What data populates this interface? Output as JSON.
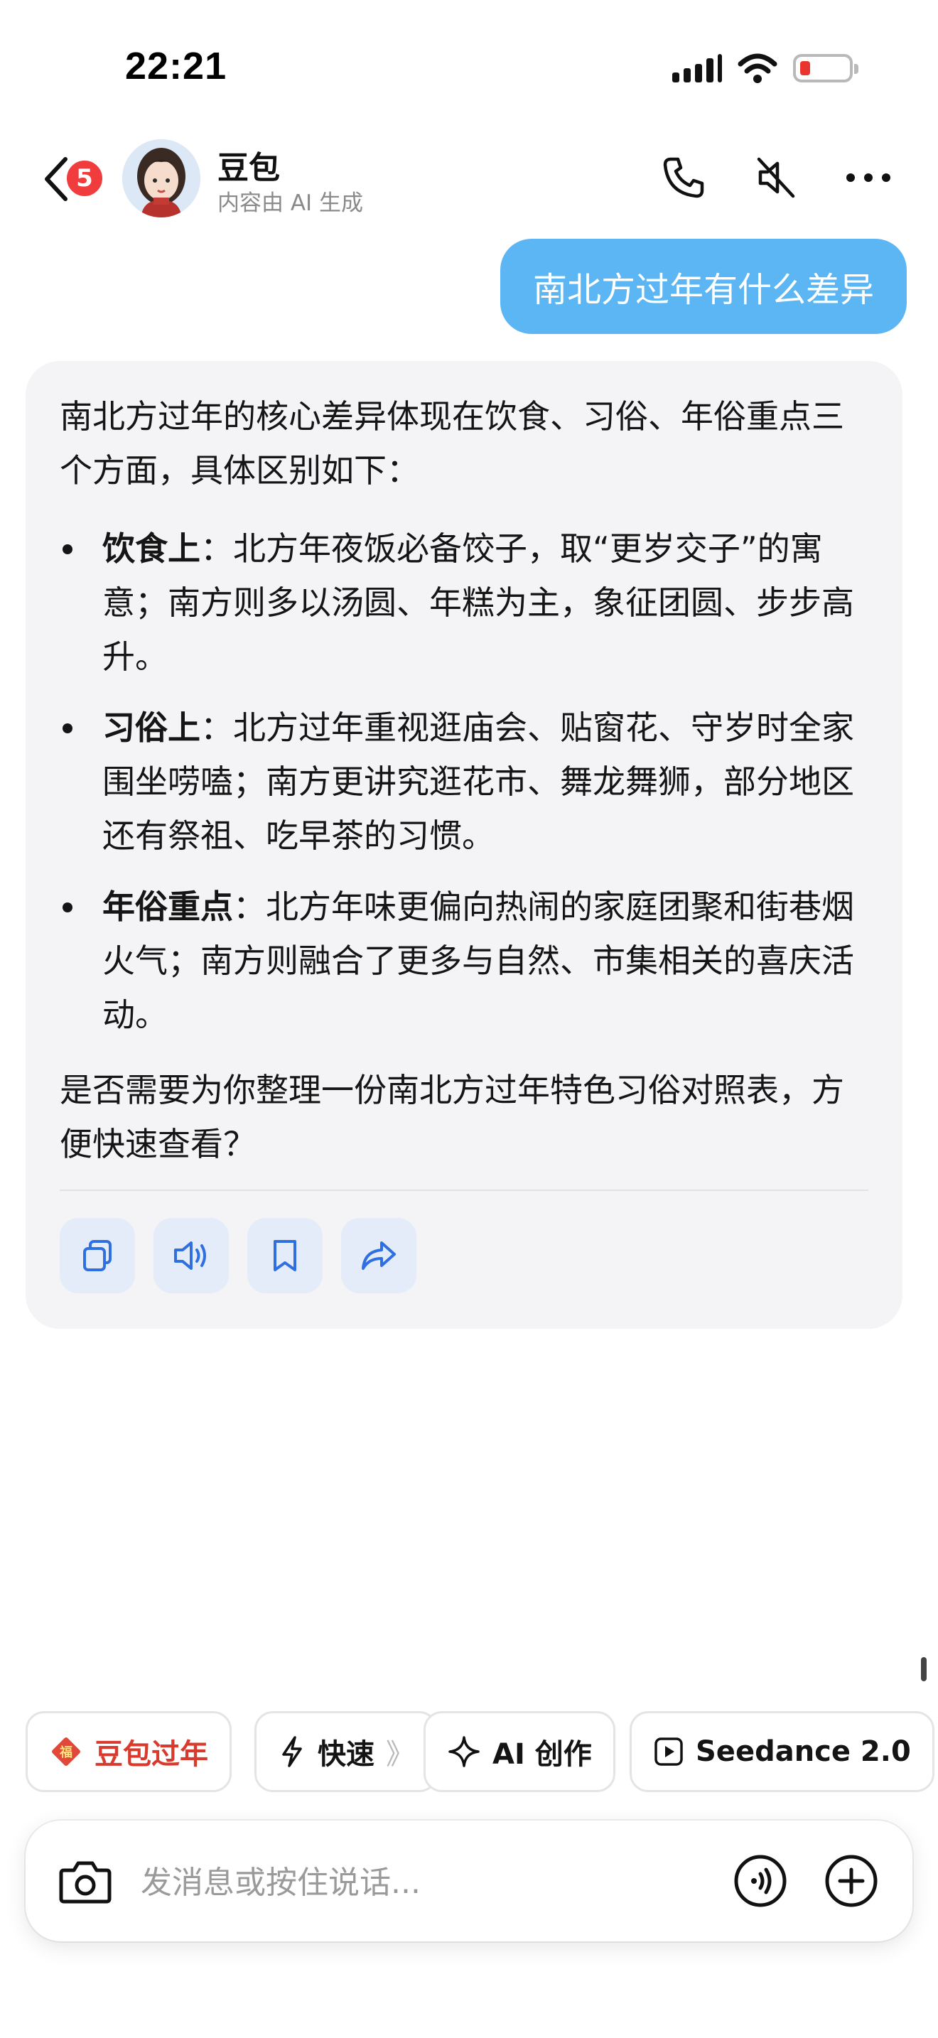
{
  "status_bar": {
    "time": "22:21",
    "signal_icon": "cellular-signal-icon",
    "wifi_icon": "wifi-icon",
    "battery_icon": "battery-low-icon",
    "battery_color": "#e8352f"
  },
  "header": {
    "unread_count": "5",
    "bot_name": "豆包",
    "bot_subtitle": "内容由 AI 生成",
    "icons": [
      "back-chevron-icon",
      "phone-icon",
      "speaker-muted-icon",
      "more-icon"
    ]
  },
  "messages": {
    "user_message": "南北方过年有什么差异",
    "ai_reply": {
      "intro": "南北方过年的核心差异体现在饮食、习俗、年俗重点三个方面，具体区别如下：",
      "bullets": [
        {
          "title": "饮食上",
          "text": "：北方年夜饭必备饺子，取“更岁交子”的寓意；南方则多以汤圆、年糕为主，象征团圆、步步高升。"
        },
        {
          "title": "习俗上",
          "text": "：北方过年重视逛庙会、贴窗花、守岁时全家围坐唠嗑；南方更讲究逛花市、舞龙舞狮，部分地区还有祭祖、吃早茶的习惯。"
        },
        {
          "title": "年俗重点",
          "text": "：北方年味更偏向热闹的家庭团聚和街巷烟火气；南方则融合了更多与自然、市集相关的喜庆活动。"
        }
      ],
      "closing": "是否需要为你整理一份南北方过年特色习俗对照表，方便快速查看？",
      "action_icons": [
        "copy-icon",
        "speaker-icon",
        "bookmark-icon",
        "share-icon"
      ]
    }
  },
  "chips": [
    {
      "label": "豆包过年",
      "icon": "fu-icon"
    },
    {
      "label": "快速",
      "suffix": "》",
      "icon": "lightning-icon"
    },
    {
      "label": "AI 创作",
      "icon": "sparkle-icon"
    },
    {
      "label": "Seedance 2.0",
      "icon": "play-icon"
    }
  ],
  "input": {
    "placeholder": "发消息或按住说话...",
    "icons": [
      "camera-icon",
      "voice-call-icon",
      "plus-icon"
    ]
  },
  "colors": {
    "user_bubble": "#5cb6f4",
    "ai_card": "#f4f4f6",
    "action_button": "#e3ecf8",
    "accent_red": "#d83a2e"
  }
}
